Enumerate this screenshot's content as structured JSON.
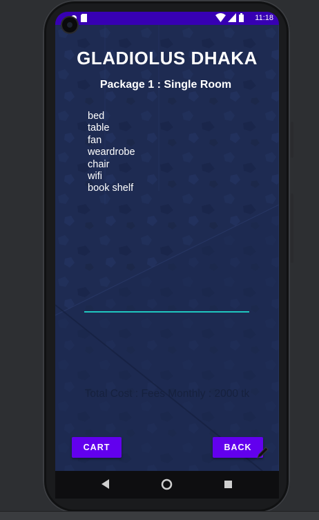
{
  "status_bar": {
    "time": "11:18",
    "icons": [
      "notification-dot-icon",
      "sd-card-icon",
      "wifi-icon",
      "signal-icon",
      "battery-icon"
    ]
  },
  "app": {
    "title": "GLADIOLUS DHAKA",
    "package": "Package 1 : Single Room",
    "features": [
      "bed",
      "table",
      "fan",
      "weardrobe",
      "chair",
      "wifi",
      "book shelf"
    ],
    "total": "Total Cost : Fees Monthly : 2000 tk",
    "cart_label": "CART",
    "back_label": "BACK"
  },
  "nav_bar": {
    "icons": [
      "back-icon",
      "home-icon",
      "recents-icon"
    ]
  },
  "colors": {
    "status_bar": "#3700b3",
    "button": "#6200ee",
    "accent_line": "#1fc8c0",
    "background": "#1e2b52"
  }
}
